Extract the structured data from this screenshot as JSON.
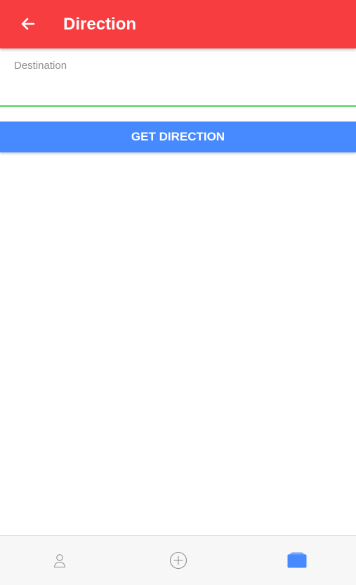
{
  "app_bar": {
    "title": "Direction",
    "back_icon": "arrow-left-icon",
    "background": "#f83d41"
  },
  "destination_field": {
    "label": "Destination",
    "value": "",
    "underline_color": "#4cd15f"
  },
  "get_direction_button": {
    "label": "GET DIRECTION",
    "background": "#478aff"
  },
  "tab_bar": {
    "tabs": [
      {
        "icon": "person-icon",
        "active": false
      },
      {
        "icon": "add-circle-icon",
        "active": false
      },
      {
        "icon": "folder-icon",
        "active": true
      }
    ],
    "active_color": "#478aff",
    "inactive_color": "#8e8e8e"
  }
}
